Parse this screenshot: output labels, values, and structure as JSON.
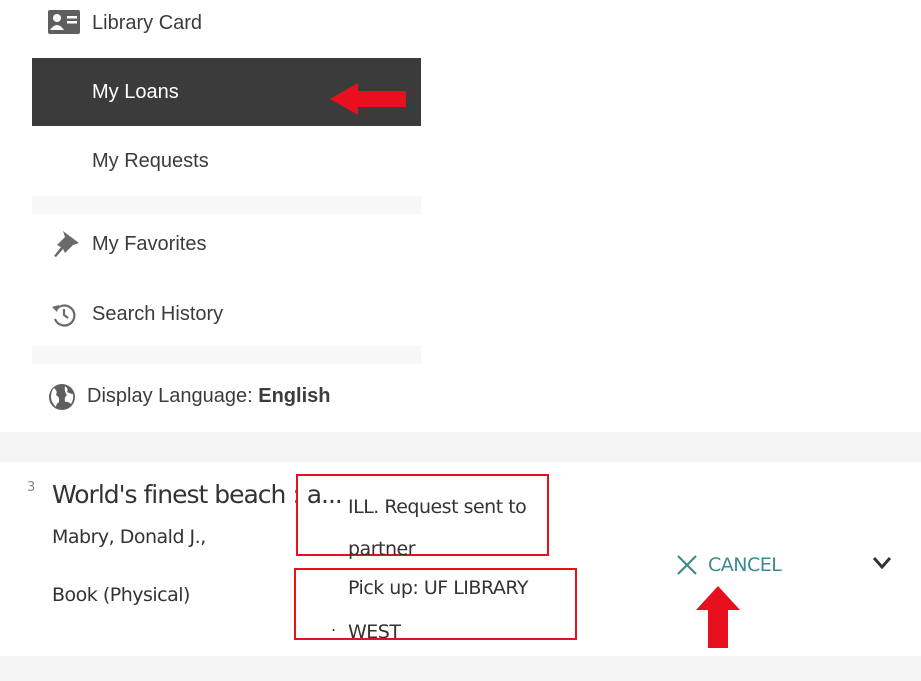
{
  "sidebar": {
    "items": [
      {
        "label": "Library Card",
        "icon": "id-card-icon"
      },
      {
        "label": "My Loans",
        "active": true
      },
      {
        "label": "My Requests"
      },
      {
        "label": "My Favorites",
        "icon": "pin-icon"
      },
      {
        "label": "Search History",
        "icon": "history-icon"
      }
    ],
    "language": {
      "prefix": "Display Language: ",
      "value": "English",
      "icon": "globe-icon"
    }
  },
  "request": {
    "index": "3",
    "title": "World's finest beach : a...",
    "author": "Mabry, Donald J.,",
    "type": "Book (Physical)",
    "status": "ILL. Request sent to partner",
    "pickup": "Pick up: UF LIBRARY WEST",
    "cancel_label": "CANCEL",
    "dot": "."
  },
  "colors": {
    "active_bg": "#3b3b3b",
    "annotation_red": "#e8101e",
    "cancel_teal": "#3d8a8f"
  }
}
